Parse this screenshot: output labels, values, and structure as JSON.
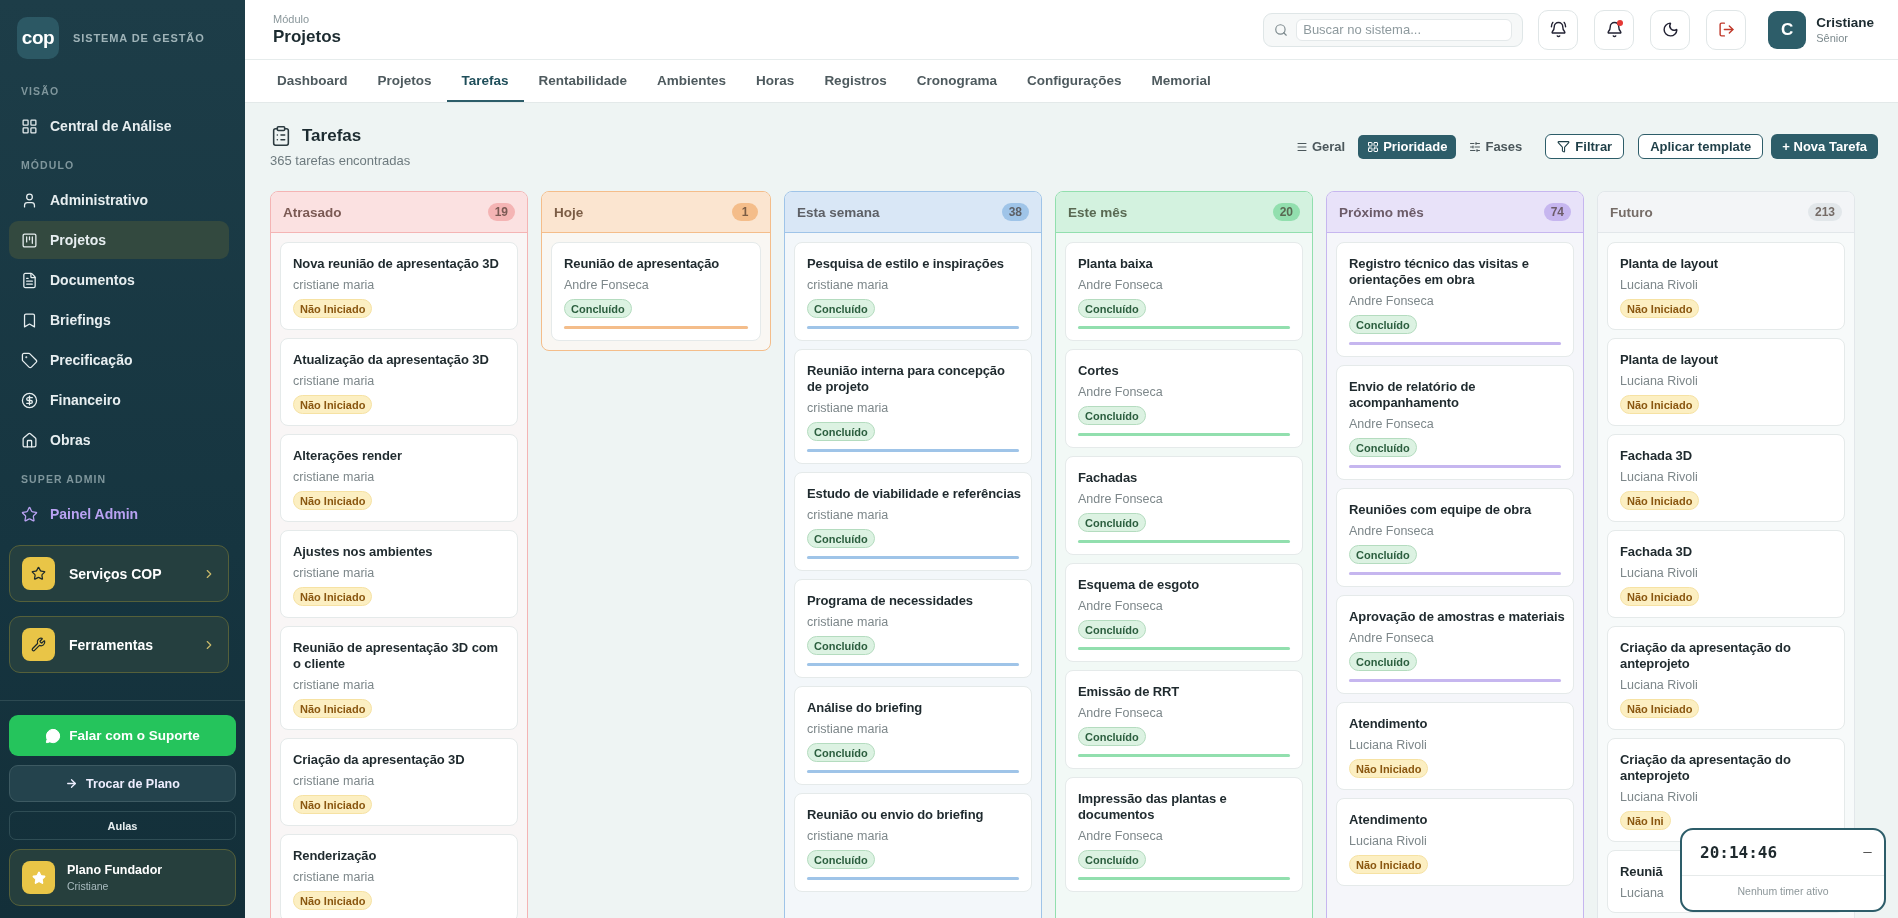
{
  "sidebar": {
    "logo": "cop",
    "brand": "SISTEMA DE GESTÃO",
    "sections": [
      {
        "title": "VISÃO",
        "kind": "nav",
        "items": [
          {
            "label": "Central de Análise",
            "selected": false
          }
        ]
      },
      {
        "title": "MÓDULO",
        "kind": "nav",
        "items": [
          {
            "label": "Administrativo",
            "selected": false
          },
          {
            "label": "Projetos",
            "selected": true
          },
          {
            "label": "Documentos",
            "selected": false
          },
          {
            "label": "Briefings",
            "selected": false
          },
          {
            "label": "Precificação",
            "selected": false
          },
          {
            "label": "Financeiro",
            "selected": false
          },
          {
            "label": "Obras",
            "selected": false
          }
        ]
      },
      {
        "title": "SUPER ADMIN",
        "kind": "admin",
        "items": [
          {
            "label": "Painel Admin",
            "selected": false
          }
        ]
      }
    ],
    "feature_cards": [
      {
        "label": "Serviços COP"
      },
      {
        "label": "Ferramentas"
      }
    ],
    "support_button": "Falar com o Suporte",
    "change_plan_button": "Trocar de Plano",
    "lessons_button": "Aulas",
    "plan": {
      "name": "Plano Fundador",
      "user": "Cristiane"
    }
  },
  "header": {
    "eyebrow": "Módulo",
    "title": "Projetos",
    "search": {
      "placeholder": "Buscar no sistema..."
    },
    "unread": true,
    "user": {
      "initial": "C",
      "name": "Cristiane",
      "role": "Sênior"
    }
  },
  "tabs": [
    {
      "label": "Dashboard",
      "selected": false
    },
    {
      "label": "Projetos",
      "selected": false
    },
    {
      "label": "Tarefas",
      "selected": true
    },
    {
      "label": "Rentabilidade",
      "selected": false
    },
    {
      "label": "Ambientes",
      "selected": false
    },
    {
      "label": "Horas",
      "selected": false
    },
    {
      "label": "Registros",
      "selected": false
    },
    {
      "label": "Cronograma",
      "selected": false
    },
    {
      "label": "Configurações",
      "selected": false
    },
    {
      "label": "Memorial",
      "selected": false
    }
  ],
  "toolbar": {
    "title": "Tarefas",
    "count": "365 tarefas encontradas",
    "views": [
      {
        "label": "Geral",
        "selected": false
      },
      {
        "label": "Prioridade",
        "selected": true
      },
      {
        "label": "Fases",
        "selected": false
      }
    ],
    "filter_button": "Filtrar",
    "template_button": "Aplicar template",
    "new_button": "+ Nova Tarefa"
  },
  "columns": [
    {
      "title": "Atrasado",
      "count": "19",
      "color": "#f4b4b4",
      "cards": [
        {
          "title": "Nova reunião de apresentação 3D",
          "assignee": "cristiane maria",
          "status": {
            "label": "Não Iniciado",
            "kind": "not_started"
          }
        },
        {
          "title": "Atualização da apresentação 3D",
          "assignee": "cristiane maria",
          "status": {
            "label": "Não Iniciado",
            "kind": "not_started"
          }
        },
        {
          "title": "Alterações render",
          "assignee": "cristiane maria",
          "status": {
            "label": "Não Iniciado",
            "kind": "not_started"
          }
        },
        {
          "title": "Ajustes nos ambientes",
          "assignee": "cristiane maria",
          "status": {
            "label": "Não Iniciado",
            "kind": "not_started"
          }
        },
        {
          "title": "Reunião de apresentação 3D com o cliente",
          "assignee": "cristiane maria",
          "status": {
            "label": "Não Iniciado",
            "kind": "not_started"
          }
        },
        {
          "title": "Criação da apresentação 3D",
          "assignee": "cristiane maria",
          "status": {
            "label": "Não Iniciado",
            "kind": "not_started"
          }
        },
        {
          "title": "Renderização",
          "assignee": "cristiane maria",
          "status": {
            "label": "Não Iniciado",
            "kind": "not_started"
          }
        }
      ]
    },
    {
      "title": "Hoje",
      "count": "1",
      "color": "#f4bd8a",
      "cards": [
        {
          "title": "Reunião de apresentação",
          "assignee": "Andre Fonseca",
          "status": {
            "label": "Concluído",
            "kind": "done"
          },
          "level": 1
        }
      ]
    },
    {
      "title": "Esta semana",
      "count": "38",
      "color": "#9fc4e8",
      "cards": [
        {
          "title": "Pesquisa de estilo e inspirações",
          "assignee": "cristiane maria",
          "status": {
            "label": "Concluído",
            "kind": "done"
          },
          "level": 1
        },
        {
          "title": "Reunião interna para concepção de projeto",
          "assignee": "cristiane maria",
          "status": {
            "label": "Concluído",
            "kind": "done"
          },
          "level": 1
        },
        {
          "title": "Estudo de viabilidade e referências",
          "assignee": "cristiane maria",
          "status": {
            "label": "Concluído",
            "kind": "done"
          },
          "level": 1
        },
        {
          "title": "Programa de necessidades",
          "assignee": "cristiane maria",
          "status": {
            "label": "Concluído",
            "kind": "done"
          },
          "level": 1
        },
        {
          "title": "Análise do briefing",
          "assignee": "cristiane maria",
          "status": {
            "label": "Concluído",
            "kind": "done"
          },
          "level": 1
        },
        {
          "title": "Reunião ou envio do briefing",
          "assignee": "cristiane maria",
          "status": {
            "label": "Concluído",
            "kind": "done"
          },
          "level": 1
        }
      ]
    },
    {
      "title": "Este mês",
      "count": "20",
      "color": "#92dfae",
      "cards": [
        {
          "title": "Planta baixa",
          "assignee": "Andre Fonseca",
          "status": {
            "label": "Concluído",
            "kind": "done"
          },
          "level": 1
        },
        {
          "title": "Cortes",
          "assignee": "Andre Fonseca",
          "status": {
            "label": "Concluído",
            "kind": "done"
          },
          "level": 1
        },
        {
          "title": "Fachadas",
          "assignee": "Andre Fonseca",
          "status": {
            "label": "Concluído",
            "kind": "done"
          },
          "level": 1
        },
        {
          "title": "Esquema de esgoto",
          "assignee": "Andre Fonseca",
          "status": {
            "label": "Concluído",
            "kind": "done"
          },
          "level": 1
        },
        {
          "title": "Emissão de RRT",
          "assignee": "Andre Fonseca",
          "status": {
            "label": "Concluído",
            "kind": "done"
          },
          "level": 1
        },
        {
          "title": "Impressão das plantas e documentos",
          "assignee": "Andre Fonseca",
          "status": {
            "label": "Concluído",
            "kind": "done"
          },
          "level": 1
        }
      ]
    },
    {
      "title": "Próximo mês",
      "count": "74",
      "color": "#c6b6ef",
      "cards": [
        {
          "title": "Registro técnico das visitas e orientações em obra",
          "assignee": "Andre Fonseca",
          "status": {
            "label": "Concluído",
            "kind": "done"
          },
          "level": 1
        },
        {
          "title": "Envio de relatório de acompanhamento",
          "assignee": "Andre Fonseca",
          "status": {
            "label": "Concluído",
            "kind": "done"
          },
          "level": 1
        },
        {
          "title": "Reuniões com equipe de obra",
          "assignee": "Andre Fonseca",
          "status": {
            "label": "Concluído",
            "kind": "done"
          },
          "level": 1
        },
        {
          "title": "Aprovação de amostras e materiais",
          "assignee": "Andre Fonseca",
          "status": {
            "label": "Concluído",
            "kind": "done"
          },
          "level": 1
        },
        {
          "title": "Atendimento",
          "assignee": "Luciana Rivoli",
          "status": {
            "label": "Não Iniciado",
            "kind": "not_started"
          }
        },
        {
          "title": "Atendimento",
          "assignee": "Luciana Rivoli",
          "status": {
            "label": "Não Iniciado",
            "kind": "not_started"
          }
        }
      ]
    },
    {
      "title": "Futuro",
      "count": "213",
      "color": "#e2e7ea",
      "cards": [
        {
          "title": "Planta de layout",
          "assignee": "Luciana Rivoli",
          "status": {
            "label": "Não Iniciado",
            "kind": "not_started"
          }
        },
        {
          "title": "Planta de layout",
          "assignee": "Luciana Rivoli",
          "status": {
            "label": "Não Iniciado",
            "kind": "not_started"
          }
        },
        {
          "title": "Fachada 3D",
          "assignee": "Luciana Rivoli",
          "status": {
            "label": "Não Iniciado",
            "kind": "not_started"
          }
        },
        {
          "title": "Fachada 3D",
          "assignee": "Luciana Rivoli",
          "status": {
            "label": "Não Iniciado",
            "kind": "not_started"
          }
        },
        {
          "title": "Criação da apresentação do anteprojeto",
          "assignee": "Luciana Rivoli",
          "status": {
            "label": "Não Iniciado",
            "kind": "not_started"
          }
        },
        {
          "title": "Criação da apresentação do anteprojeto",
          "assignee": "Luciana Rivoli",
          "status": {
            "label": "Não Ini",
            "kind": "not_started"
          }
        },
        {
          "title": "Reuniã",
          "assignee": "Luciana"
        }
      ]
    }
  ],
  "timer": {
    "time": "20:14:46",
    "status": "Nenhum timer ativo"
  }
}
